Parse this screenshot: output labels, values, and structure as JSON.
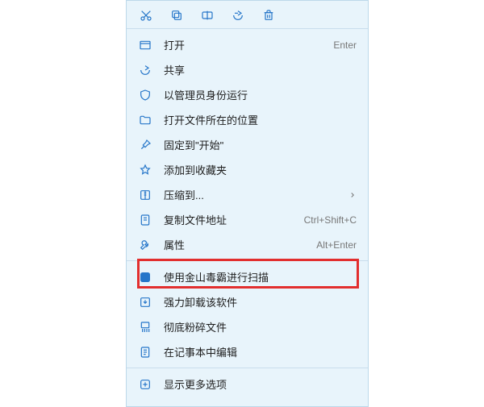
{
  "toolbar": {
    "items": [
      {
        "name": "cut-icon"
      },
      {
        "name": "copy-icon"
      },
      {
        "name": "rename-icon"
      },
      {
        "name": "share-icon"
      },
      {
        "name": "delete-icon"
      }
    ]
  },
  "menu": {
    "open": {
      "label": "打开",
      "shortcut": "Enter"
    },
    "share": {
      "label": "共享",
      "shortcut": ""
    },
    "runadmin": {
      "label": "以管理员身份运行",
      "shortcut": ""
    },
    "openloc": {
      "label": "打开文件所在的位置",
      "shortcut": ""
    },
    "pinstart": {
      "label": "固定到\"开始\"",
      "shortcut": ""
    },
    "addfav": {
      "label": "添加到收藏夹",
      "shortcut": ""
    },
    "compress": {
      "label": "压缩到...",
      "shortcut": "",
      "submenu": true
    },
    "copypath": {
      "label": "复制文件地址",
      "shortcut": "Ctrl+Shift+C"
    },
    "properties": {
      "label": "属性",
      "shortcut": "Alt+Enter"
    },
    "scan": {
      "label": "使用金山毒霸进行扫描",
      "shortcut": ""
    },
    "uninstall": {
      "label": "强力卸载该软件",
      "shortcut": ""
    },
    "shred": {
      "label": "彻底粉碎文件",
      "shortcut": ""
    },
    "editnote": {
      "label": "在记事本中编辑",
      "shortcut": ""
    },
    "more": {
      "label": "显示更多选项",
      "shortcut": ""
    }
  }
}
